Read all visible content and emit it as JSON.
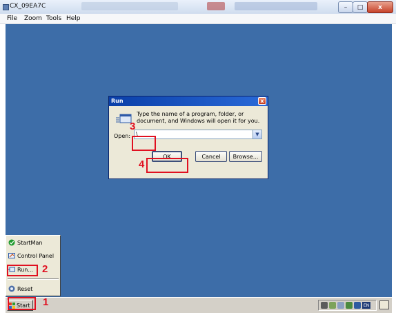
{
  "host": {
    "title": "CX_09EA7C",
    "menu": [
      "File",
      "Zoom",
      "Tools",
      "Help"
    ],
    "controls": {
      "minimize": "–",
      "maximize": "□",
      "close": "x"
    }
  },
  "run_dialog": {
    "title": "Run",
    "close": "x",
    "message": "Type the name of a program, folder, or document, and Windows will open it for you.",
    "open_label": "Open:",
    "open_value": "\\",
    "ok_label": "OK",
    "cancel_label": "Cancel",
    "browse_label": "Browse..."
  },
  "start_menu": {
    "items": [
      {
        "label": "StartMan",
        "icon": "check-icon"
      },
      {
        "label": "Control Panel",
        "icon": "control-panel-icon"
      },
      {
        "label": "Run...",
        "icon": "run-icon"
      },
      {
        "label": "Reset",
        "icon": "reset-icon"
      }
    ]
  },
  "taskbar": {
    "start_label": "Start",
    "language": "EN"
  },
  "annotations": [
    "1",
    "2",
    "3",
    "4"
  ],
  "colors": {
    "desktop": "#3d6da8",
    "highlight_box": "#e01020",
    "titlebar": "#0a3fa8"
  }
}
